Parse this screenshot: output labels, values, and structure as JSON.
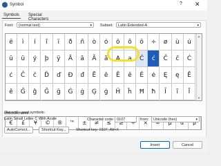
{
  "window": {
    "title": "Symbol",
    "help_glyph": "?",
    "close_glyph": "✕"
  },
  "tabs": [
    {
      "label": "Symbols"
    },
    {
      "label": "Special Characters"
    }
  ],
  "font": {
    "label": "Font:",
    "value": "(normal text)"
  },
  "subset": {
    "label": "Subset:",
    "value": "Latin Extended-A"
  },
  "grid": {
    "rows": [
      [
        "ë",
        "ì",
        "í",
        "î",
        "ï",
        "ð",
        "ñ",
        "ò",
        "ó",
        "ô",
        "õ",
        "ö",
        "÷",
        "ø",
        "ù",
        "ú"
      ],
      [
        "û",
        "ü",
        "ý",
        "þ",
        "ÿ",
        "Ā",
        "ā",
        "Ă",
        "ă",
        "Ą",
        "ą",
        "Ć",
        "ć",
        "Ĉ",
        "ĉ",
        "Ċ"
      ],
      [
        "ċ",
        "Č",
        "č",
        "Ď",
        "ď",
        "Đ",
        "đ",
        "Ē",
        "ē",
        "Ĕ",
        "ĕ",
        "Ė",
        "ė",
        "Ę",
        "ę",
        "Ě"
      ],
      [
        "ě",
        "Ĝ",
        "ĝ",
        "Ğ",
        "ğ",
        "Ġ",
        "ġ",
        "Ģ",
        "ģ",
        "Ĥ",
        "ĥ",
        "Ħ",
        "ħ",
        "Ĩ",
        "ĩ",
        "Ī"
      ]
    ]
  },
  "recent": {
    "label": "Recently used symbols:",
    "items": [
      "€",
      "£",
      "¥",
      "©",
      "®",
      "™",
      "±",
      "≠",
      "≤",
      "≥",
      "÷",
      "×",
      "∞",
      "µ",
      "α",
      "β"
    ]
  },
  "unicode_name": {
    "label": "Unicode name:",
    "value": "Latin Small Letter C With Acute"
  },
  "character_code": {
    "label": "Character code:",
    "value": "0107"
  },
  "from": {
    "label": "from:",
    "value": "Unicode (hex)"
  },
  "buttons": {
    "autocorrect": "AutoCorrect...",
    "shortcut_key": "Shortcut Key...",
    "insert": "Insert",
    "cancel": "Cancel"
  },
  "shortcut_text": "Shortcut key: 0107, Alt+X"
}
